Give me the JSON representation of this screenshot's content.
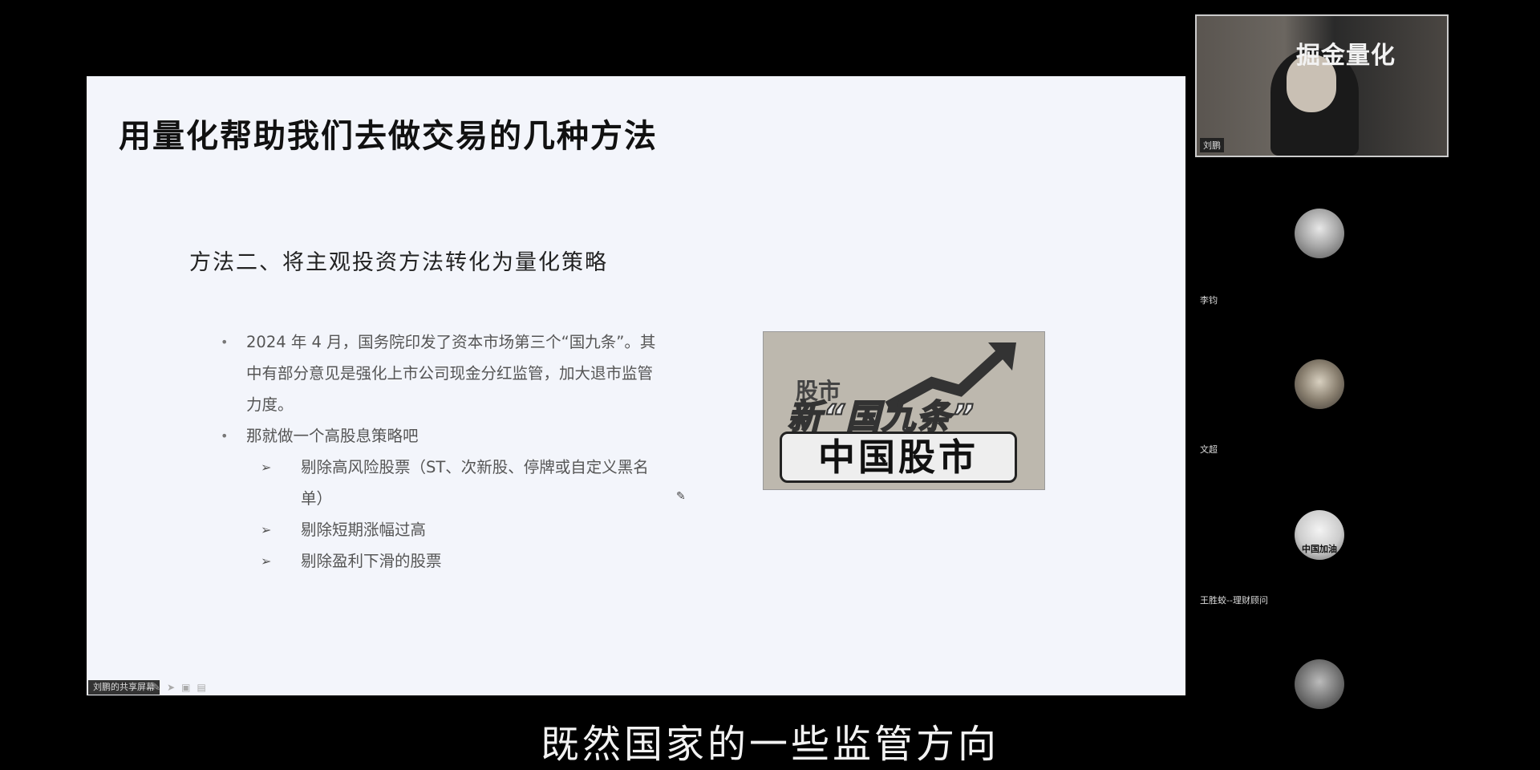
{
  "slide": {
    "title": "用量化帮助我们去做交易的几种方法",
    "subtitle": "方法二、将主观投资方法转化为量化策略",
    "bullets": [
      {
        "text": "2024 年 4 月，国务院印发了资本市场第三个“国九条”。其中有部分意见是强化上市公司现金分红监管，加大退市监管力度。"
      },
      {
        "text": "那就做一个高股息策略吧"
      }
    ],
    "sub_bullets": [
      "剔除高风险股票（ST、次新股、停牌或自定义黑名单）",
      "剔除短期涨幅过高",
      "剔除盈利下滑的股票"
    ],
    "image": {
      "top_text": "股市",
      "middle_text": "新“国九条”",
      "bottom_text": "中国股市"
    }
  },
  "share_bar": {
    "label": "刘鹏的共享屏幕"
  },
  "video": {
    "watermark": "掘金量化",
    "name": "刘鹏"
  },
  "participants": [
    {
      "name": "李钧"
    },
    {
      "name": "文超"
    },
    {
      "name": "王胜蛟--理财顾问",
      "avatar_text": "中国加油"
    },
    {
      "name": ""
    }
  ],
  "caption": "既然国家的一些监管方向"
}
